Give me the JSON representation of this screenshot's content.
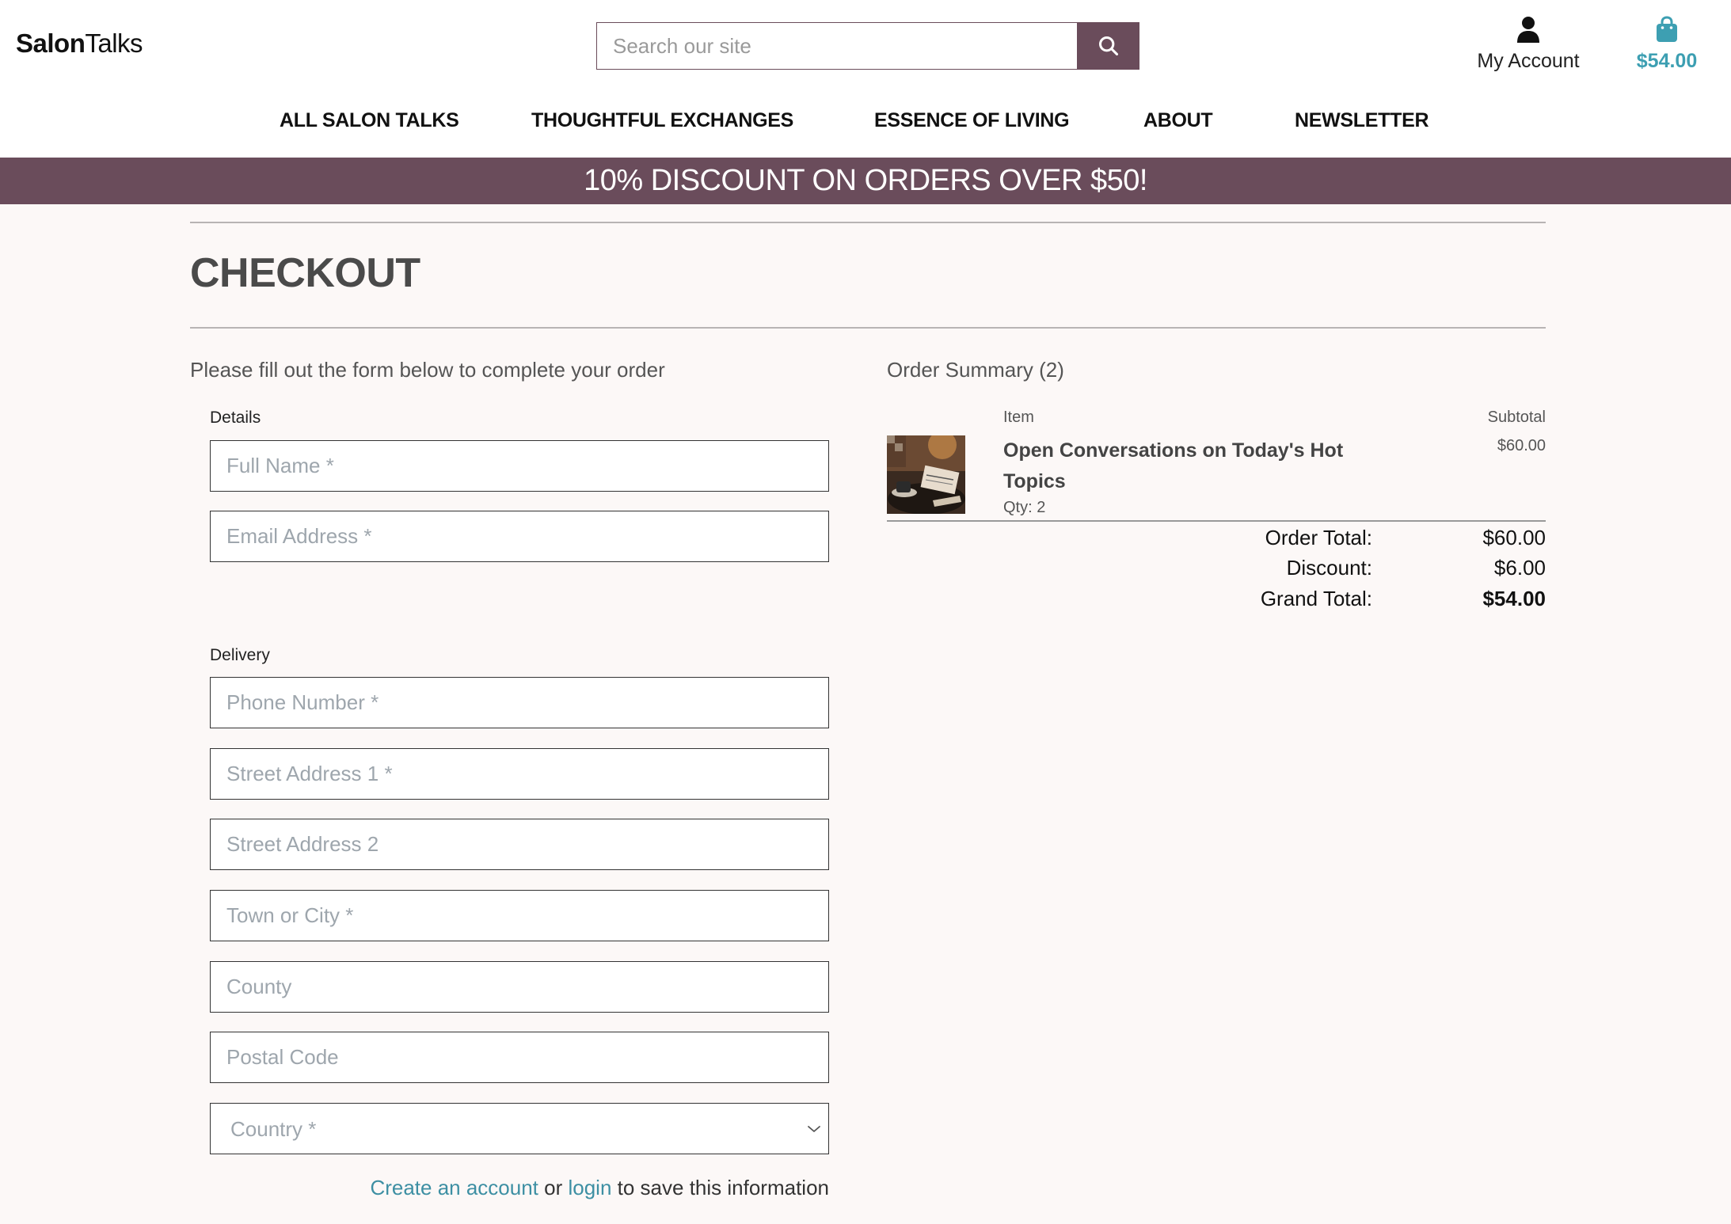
{
  "header": {
    "logo_bold": "Salon",
    "logo_thin": "Talks",
    "search_placeholder": "Search our site",
    "account_label": "My Account",
    "bag_total": "$54.00"
  },
  "nav": {
    "items": [
      "ALL SALON TALKS",
      "THOUGHTFUL EXCHANGES",
      "ESSENCE OF LIVING",
      "ABOUT",
      "NEWSLETTER"
    ]
  },
  "banner": {
    "text": "10% DISCOUNT ON ORDERS OVER $50!"
  },
  "page": {
    "title": "CHECKOUT",
    "intro": "Please fill out the form below to complete your order"
  },
  "form": {
    "details_label": "Details",
    "delivery_label": "Delivery",
    "full_name_placeholder": "Full Name *",
    "email_placeholder": "Email Address *",
    "phone_placeholder": "Phone Number *",
    "street1_placeholder": "Street Address 1 *",
    "street2_placeholder": "Street Address 2",
    "town_placeholder": "Town or City *",
    "county_placeholder": "County",
    "postcode_placeholder": "Postal Code",
    "country_placeholder": "Country *",
    "save_create": "Create an account",
    "save_or": " or ",
    "save_login": "login",
    "save_rest": " to save this information"
  },
  "summary": {
    "title": "Order Summary (2)",
    "col_item": "Item",
    "col_subtotal": "Subtotal",
    "item_title": "Open Conversations on Today's Hot Topics",
    "item_qty": "Qty: 2",
    "item_subtotal": "$60.00",
    "order_total_label": "Order Total:",
    "order_total": "$60.00",
    "discount_label": "Discount:",
    "discount": "$6.00",
    "grand_total_label": "Grand Total:",
    "grand_total": "$54.00"
  },
  "colors": {
    "brand": "#6a4c5b",
    "accent": "#3d9fb2",
    "background": "#fcf8f7"
  },
  "icons": {
    "search": "search-icon",
    "account": "user-icon",
    "bag": "shopping-bag-icon",
    "dropdown": "chevron-down-icon"
  }
}
